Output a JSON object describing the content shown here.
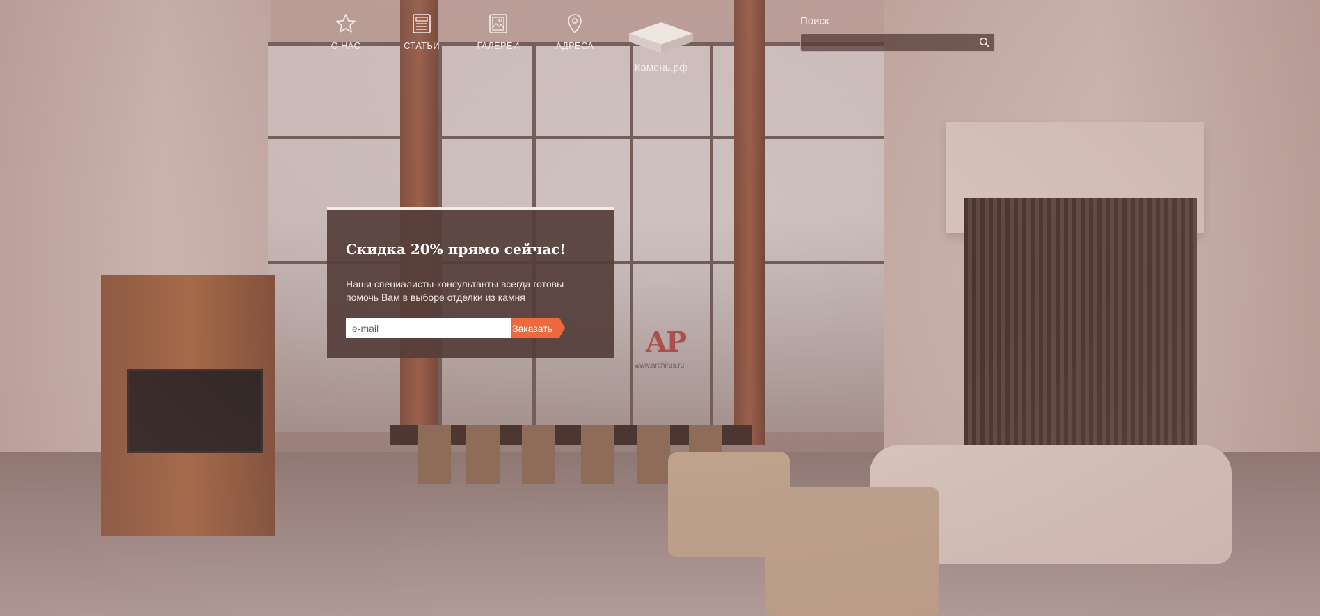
{
  "nav": {
    "items": [
      {
        "label": "О НАС",
        "icon": "star-icon"
      },
      {
        "label": "СТАТЬИ",
        "icon": "newspaper-icon"
      },
      {
        "label": "ГАЛЕРЕИ",
        "icon": "gallery-icon"
      },
      {
        "label": "АДРЕСА",
        "icon": "map-pin-icon"
      }
    ],
    "logo_text": "Камень.рф"
  },
  "search": {
    "label": "Поиск",
    "value": "",
    "placeholder": ""
  },
  "promo": {
    "title": "Скидка 20% прямо сейчас!",
    "text": "Наши специалисты-консультанты всегда готовы помочь Вам в выборе отделки из камня",
    "email_placeholder": "e-mail",
    "button_label": "Заказать"
  },
  "watermark": {
    "logo": "AP",
    "url": "www.archirus.ru"
  },
  "colors": {
    "accent": "#ee6a3e",
    "card": "#553e39",
    "text_light": "#f4ebe7"
  }
}
